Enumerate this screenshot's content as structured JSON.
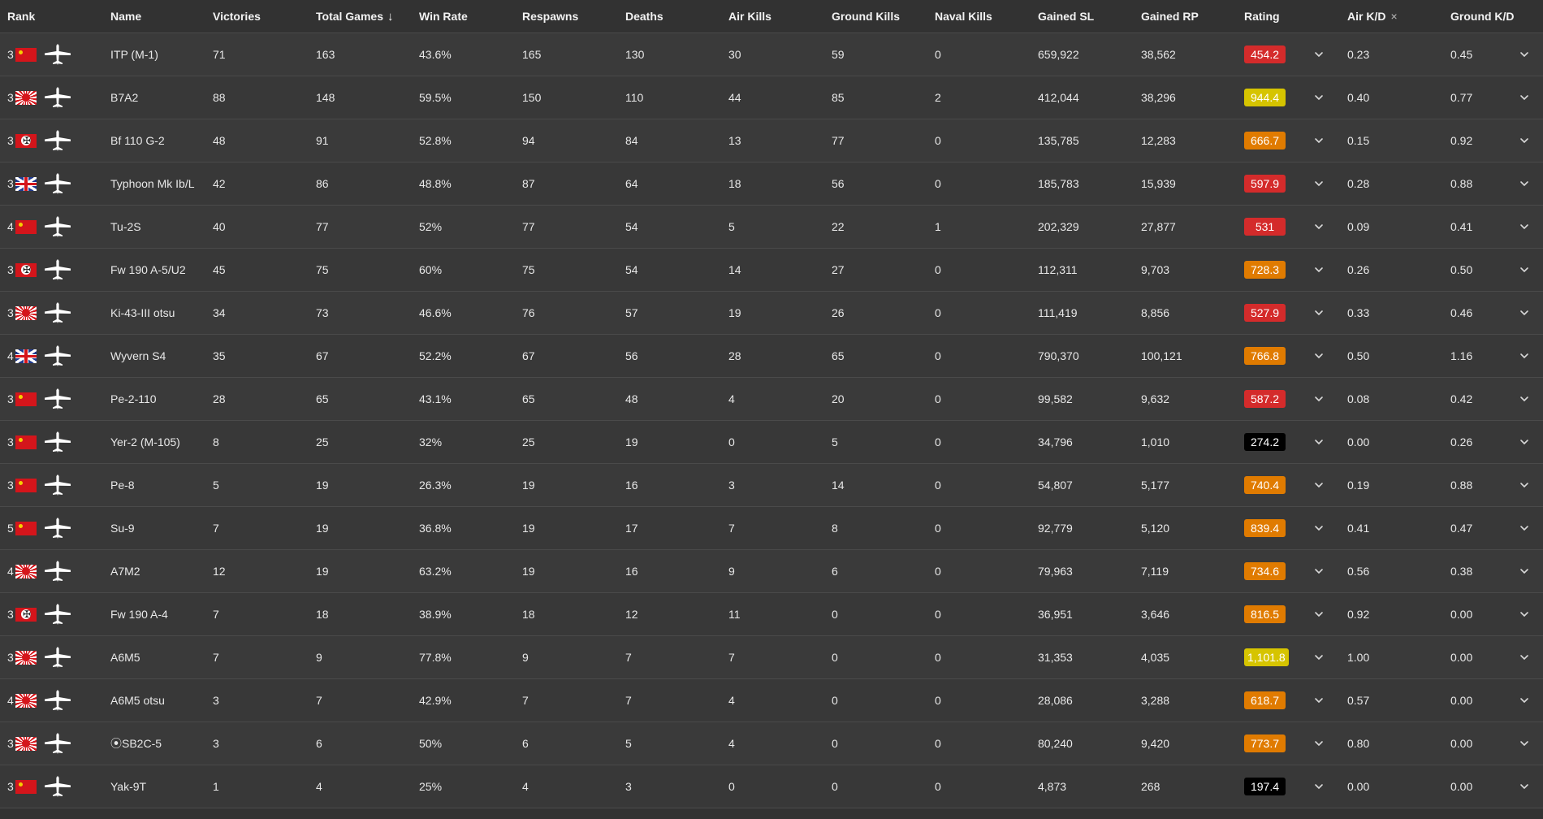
{
  "header": {
    "rank": "Rank",
    "name": "Name",
    "victories": "Victories",
    "total_games": "Total Games",
    "sort_icon": "arrow-down-icon",
    "win_rate": "Win Rate",
    "respawns": "Respawns",
    "deaths": "Deaths",
    "air_kills": "Air Kills",
    "ground_kills": "Ground Kills",
    "naval_kills": "Naval Kills",
    "gained_sl": "Gained SL",
    "gained_rp": "Gained RP",
    "rating": "Rating",
    "air_kd": "Air K/D",
    "close_symbol": "×",
    "ground_kd": "Ground K/D"
  },
  "colors": {
    "rating_red": "#d42b2b",
    "rating_orange": "#e07b00",
    "rating_yellow": "#d6c400",
    "rating_black": "#000000"
  },
  "rows": [
    {
      "rank": "3",
      "country": "ussr",
      "name": "ITP (M-1)",
      "victories": "71",
      "total_games": "163",
      "win_rate": "43.6%",
      "respawns": "165",
      "deaths": "130",
      "air_kills": "30",
      "ground_kills": "59",
      "naval_kills": "0",
      "gained_sl": "659,922",
      "gained_rp": "38,562",
      "rating": "454.2",
      "rating_color": "red",
      "air_kd": "0.23",
      "ground_kd": "0.45"
    },
    {
      "rank": "3",
      "country": "japan",
      "name": "B7A2",
      "victories": "88",
      "total_games": "148",
      "win_rate": "59.5%",
      "respawns": "150",
      "deaths": "110",
      "air_kills": "44",
      "ground_kills": "85",
      "naval_kills": "2",
      "gained_sl": "412,044",
      "gained_rp": "38,296",
      "rating": "944.4",
      "rating_color": "yellow",
      "air_kd": "0.40",
      "ground_kd": "0.77"
    },
    {
      "rank": "3",
      "country": "germany",
      "name": "Bf 110 G-2",
      "victories": "48",
      "total_games": "91",
      "win_rate": "52.8%",
      "respawns": "94",
      "deaths": "84",
      "air_kills": "13",
      "ground_kills": "77",
      "naval_kills": "0",
      "gained_sl": "135,785",
      "gained_rp": "12,283",
      "rating": "666.7",
      "rating_color": "orange",
      "air_kd": "0.15",
      "ground_kd": "0.92"
    },
    {
      "rank": "3",
      "country": "uk",
      "name": "Typhoon Mk Ib/L",
      "victories": "42",
      "total_games": "86",
      "win_rate": "48.8%",
      "respawns": "87",
      "deaths": "64",
      "air_kills": "18",
      "ground_kills": "56",
      "naval_kills": "0",
      "gained_sl": "185,783",
      "gained_rp": "15,939",
      "rating": "597.9",
      "rating_color": "red",
      "air_kd": "0.28",
      "ground_kd": "0.88"
    },
    {
      "rank": "4",
      "country": "ussr",
      "name": "Tu-2S",
      "victories": "40",
      "total_games": "77",
      "win_rate": "52%",
      "respawns": "77",
      "deaths": "54",
      "air_kills": "5",
      "ground_kills": "22",
      "naval_kills": "1",
      "gained_sl": "202,329",
      "gained_rp": "27,877",
      "rating": "531",
      "rating_color": "red",
      "air_kd": "0.09",
      "ground_kd": "0.41"
    },
    {
      "rank": "3",
      "country": "germany",
      "name": "Fw 190 A-5/U2",
      "victories": "45",
      "total_games": "75",
      "win_rate": "60%",
      "respawns": "75",
      "deaths": "54",
      "air_kills": "14",
      "ground_kills": "27",
      "naval_kills": "0",
      "gained_sl": "112,311",
      "gained_rp": "9,703",
      "rating": "728.3",
      "rating_color": "orange",
      "air_kd": "0.26",
      "ground_kd": "0.50"
    },
    {
      "rank": "3",
      "country": "japan",
      "name": "Ki-43-III otsu",
      "victories": "34",
      "total_games": "73",
      "win_rate": "46.6%",
      "respawns": "76",
      "deaths": "57",
      "air_kills": "19",
      "ground_kills": "26",
      "naval_kills": "0",
      "gained_sl": "111,419",
      "gained_rp": "8,856",
      "rating": "527.9",
      "rating_color": "red",
      "air_kd": "0.33",
      "ground_kd": "0.46"
    },
    {
      "rank": "4",
      "country": "uk",
      "name": "Wyvern S4",
      "victories": "35",
      "total_games": "67",
      "win_rate": "52.2%",
      "respawns": "67",
      "deaths": "56",
      "air_kills": "28",
      "ground_kills": "65",
      "naval_kills": "0",
      "gained_sl": "790,370",
      "gained_rp": "100,121",
      "rating": "766.8",
      "rating_color": "orange",
      "air_kd": "0.50",
      "ground_kd": "1.16"
    },
    {
      "rank": "3",
      "country": "ussr",
      "name": "Pe-2-110",
      "victories": "28",
      "total_games": "65",
      "win_rate": "43.1%",
      "respawns": "65",
      "deaths": "48",
      "air_kills": "4",
      "ground_kills": "20",
      "naval_kills": "0",
      "gained_sl": "99,582",
      "gained_rp": "9,632",
      "rating": "587.2",
      "rating_color": "red",
      "air_kd": "0.08",
      "ground_kd": "0.42"
    },
    {
      "rank": "3",
      "country": "ussr",
      "name": "Yer-2 (M-105)",
      "victories": "8",
      "total_games": "25",
      "win_rate": "32%",
      "respawns": "25",
      "deaths": "19",
      "air_kills": "0",
      "ground_kills": "5",
      "naval_kills": "0",
      "gained_sl": "34,796",
      "gained_rp": "1,010",
      "rating": "274.2",
      "rating_color": "black",
      "air_kd": "0.00",
      "ground_kd": "0.26"
    },
    {
      "rank": "3",
      "country": "ussr",
      "name": "Pe-8",
      "victories": "5",
      "total_games": "19",
      "win_rate": "26.3%",
      "respawns": "19",
      "deaths": "16",
      "air_kills": "3",
      "ground_kills": "14",
      "naval_kills": "0",
      "gained_sl": "54,807",
      "gained_rp": "5,177",
      "rating": "740.4",
      "rating_color": "orange",
      "air_kd": "0.19",
      "ground_kd": "0.88"
    },
    {
      "rank": "5",
      "country": "ussr",
      "name": "Su-9",
      "victories": "7",
      "total_games": "19",
      "win_rate": "36.8%",
      "respawns": "19",
      "deaths": "17",
      "air_kills": "7",
      "ground_kills": "8",
      "naval_kills": "0",
      "gained_sl": "92,779",
      "gained_rp": "5,120",
      "rating": "839.4",
      "rating_color": "orange",
      "air_kd": "0.41",
      "ground_kd": "0.47"
    },
    {
      "rank": "4",
      "country": "japan",
      "name": "A7M2",
      "victories": "12",
      "total_games": "19",
      "win_rate": "63.2%",
      "respawns": "19",
      "deaths": "16",
      "air_kills": "9",
      "ground_kills": "6",
      "naval_kills": "0",
      "gained_sl": "79,963",
      "gained_rp": "7,119",
      "rating": "734.6",
      "rating_color": "orange",
      "air_kd": "0.56",
      "ground_kd": "0.38"
    },
    {
      "rank": "3",
      "country": "germany",
      "name": "Fw 190 A-4",
      "victories": "7",
      "total_games": "18",
      "win_rate": "38.9%",
      "respawns": "18",
      "deaths": "12",
      "air_kills": "11",
      "ground_kills": "0",
      "naval_kills": "0",
      "gained_sl": "36,951",
      "gained_rp": "3,646",
      "rating": "816.5",
      "rating_color": "orange",
      "air_kd": "0.92",
      "ground_kd": "0.00"
    },
    {
      "rank": "3",
      "country": "japan",
      "name": "A6M5",
      "victories": "7",
      "total_games": "9",
      "win_rate": "77.8%",
      "respawns": "9",
      "deaths": "7",
      "air_kills": "7",
      "ground_kills": "0",
      "naval_kills": "0",
      "gained_sl": "31,353",
      "gained_rp": "4,035",
      "rating": "1,101.8",
      "rating_color": "yellow",
      "air_kd": "1.00",
      "ground_kd": "0.00"
    },
    {
      "rank": "4",
      "country": "japan",
      "name": "A6M5 otsu",
      "victories": "3",
      "total_games": "7",
      "win_rate": "42.9%",
      "respawns": "7",
      "deaths": "7",
      "air_kills": "4",
      "ground_kills": "0",
      "naval_kills": "0",
      "gained_sl": "28,086",
      "gained_rp": "3,288",
      "rating": "618.7",
      "rating_color": "orange",
      "air_kd": "0.57",
      "ground_kd": "0.00"
    },
    {
      "rank": "3",
      "country": "japan",
      "name": "⦿SB2C-5",
      "victories": "3",
      "total_games": "6",
      "win_rate": "50%",
      "respawns": "6",
      "deaths": "5",
      "air_kills": "4",
      "ground_kills": "0",
      "naval_kills": "0",
      "gained_sl": "80,240",
      "gained_rp": "9,420",
      "rating": "773.7",
      "rating_color": "orange",
      "air_kd": "0.80",
      "ground_kd": "0.00"
    },
    {
      "rank": "3",
      "country": "ussr",
      "name": "Yak-9T",
      "victories": "1",
      "total_games": "4",
      "win_rate": "25%",
      "respawns": "4",
      "deaths": "3",
      "air_kills": "0",
      "ground_kills": "0",
      "naval_kills": "0",
      "gained_sl": "4,873",
      "gained_rp": "268",
      "rating": "197.4",
      "rating_color": "black",
      "air_kd": "0.00",
      "ground_kd": "0.00"
    }
  ]
}
